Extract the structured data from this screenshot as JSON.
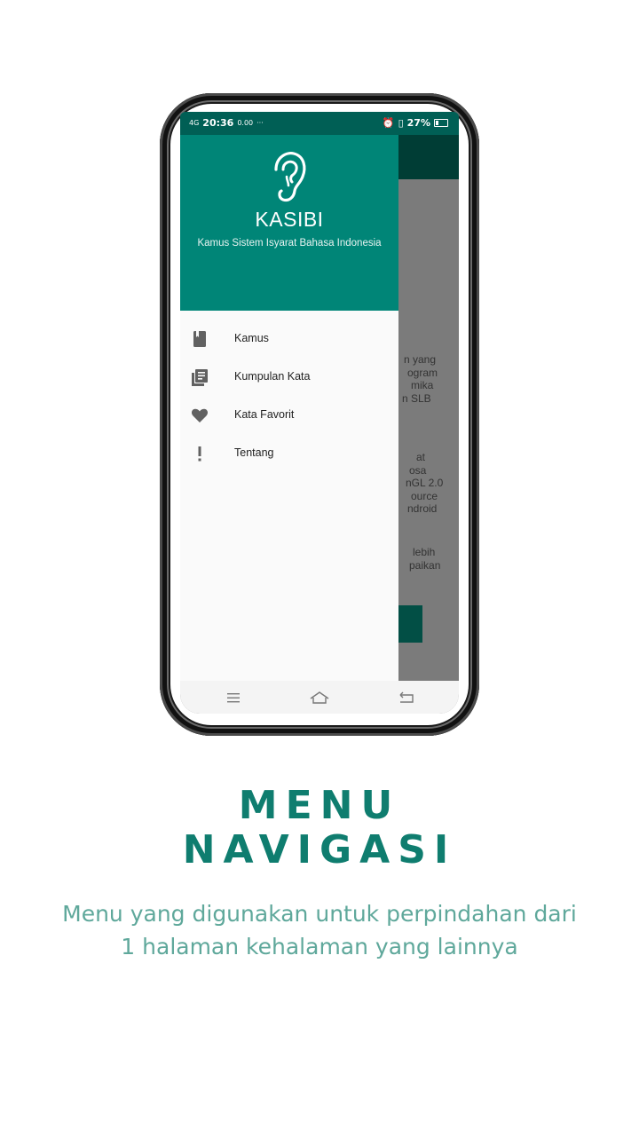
{
  "status_bar": {
    "network": "4G",
    "time": "20:36",
    "speed": "0.00 KB/s",
    "battery": "27%",
    "more": "···"
  },
  "drawer": {
    "app_name": "KASIBI",
    "subtitle": "Kamus Sistem Isyarat Bahasa Indonesia",
    "menu": [
      {
        "label": "Kamus",
        "icon": "book-icon"
      },
      {
        "label": "Kumpulan Kata",
        "icon": "library-icon"
      },
      {
        "label": "Kata Favorit",
        "icon": "heart-icon"
      },
      {
        "label": "Tentang",
        "icon": "exclamation-icon"
      }
    ]
  },
  "background_text": {
    "para1": [
      "n yang",
      "ogram",
      "mika",
      "n SLB"
    ],
    "para2": [
      "at",
      "osa",
      "nGL 2.0",
      "ource",
      "ndroid"
    ],
    "para3": [
      "lebih",
      "paikan"
    ]
  },
  "promo": {
    "title_line1": "MENU",
    "title_line2": "NAVIGASI",
    "desc_line1": "Menu yang digunakan untuk perpindahan dari",
    "desc_line2": "1 halaman kehalaman yang lainnya"
  },
  "colors": {
    "primary": "#008577",
    "primary_dark": "#005f55",
    "title": "#0f7d6f",
    "desc": "#5fa89b"
  }
}
